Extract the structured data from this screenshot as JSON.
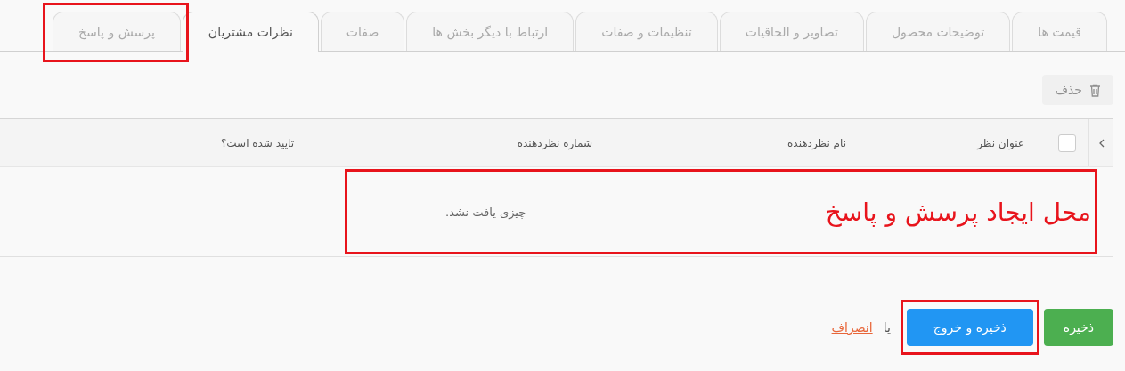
{
  "tabs": [
    {
      "label": "قیمت ها",
      "selected": false,
      "highlighted": false
    },
    {
      "label": "توضیحات محصول",
      "selected": false,
      "highlighted": false
    },
    {
      "label": "تصاویر و الحاقیات",
      "selected": false,
      "highlighted": false
    },
    {
      "label": "تنظیمات و صفات",
      "selected": false,
      "highlighted": false
    },
    {
      "label": "ارتباط با دیگر بخش ها",
      "selected": false,
      "highlighted": false
    },
    {
      "label": "صفات",
      "selected": false,
      "highlighted": false
    },
    {
      "label": "نظرات مشتریان",
      "selected": true,
      "highlighted": false
    },
    {
      "label": "پرسش و پاسخ",
      "selected": false,
      "highlighted": true
    }
  ],
  "toolbar": {
    "delete_button": {
      "label": "حذف",
      "disabled": true
    }
  },
  "table": {
    "select_all": {
      "checked": false
    },
    "columns": [
      "عنوان نظر",
      "نام نظردهنده",
      "شماره نظردهنده",
      "تایید شده است؟"
    ],
    "empty_message": "چیزی یافت نشد.",
    "annotation": "محل ایجاد پرسش و پاسخ"
  },
  "actions": {
    "buttons": [
      {
        "label": "ذخیره",
        "kind": "success",
        "highlighted": false
      },
      {
        "label": "ذخیره و خروج",
        "kind": "primary",
        "highlighted": true
      }
    ],
    "separator": "یا",
    "cancel_link": "انصراف"
  }
}
